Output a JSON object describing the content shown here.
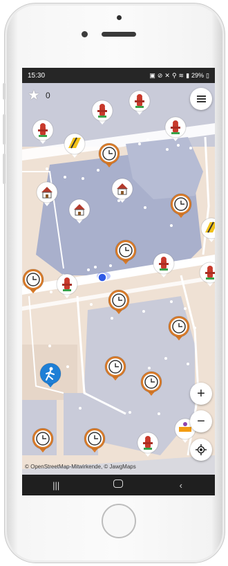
{
  "status_bar": {
    "time": "15:30",
    "battery": "29%",
    "icons": [
      "sim-card-icon",
      "no-bell-icon",
      "mute-icon",
      "location-icon",
      "wifi-icon",
      "signal-icon"
    ]
  },
  "top_bar": {
    "stars_count": "0",
    "menu_icon": "hamburger-menu-icon"
  },
  "map_controls": {
    "zoom_in": "+",
    "zoom_out": "−",
    "locate_icon": "my-location-icon"
  },
  "attribution": "© OpenStreetMap-Mitwirkende, © JawgMaps",
  "nav_bar": {
    "recents": "|||",
    "home": "home-icon",
    "back": "‹"
  },
  "map": {
    "colors": {
      "land": "#efe1d4",
      "building": "#a9b0cc",
      "block": "#c9cbd9",
      "road": "#ffffff",
      "pin_border_clock": "#d97b29",
      "pin_border_generic": "#ffffff"
    },
    "pin_types": [
      "fire-hydrant",
      "clock",
      "house",
      "roadworks",
      "pedestrian",
      "construction"
    ],
    "pins": [
      {
        "kind": "fire-hydrant"
      },
      {
        "kind": "fire-hydrant"
      },
      {
        "kind": "fire-hydrant"
      },
      {
        "kind": "fire-hydrant"
      },
      {
        "kind": "roadworks"
      },
      {
        "kind": "clock"
      },
      {
        "kind": "house"
      },
      {
        "kind": "house"
      },
      {
        "kind": "house"
      },
      {
        "kind": "clock"
      },
      {
        "kind": "clock"
      },
      {
        "kind": "clock"
      },
      {
        "kind": "fire-hydrant"
      },
      {
        "kind": "fire-hydrant"
      },
      {
        "kind": "fire-hydrant"
      },
      {
        "kind": "clock"
      },
      {
        "kind": "clock"
      },
      {
        "kind": "clock"
      },
      {
        "kind": "clock"
      },
      {
        "kind": "pedestrian"
      },
      {
        "kind": "clock"
      },
      {
        "kind": "clock"
      },
      {
        "kind": "fire-hydrant"
      },
      {
        "kind": "construction"
      },
      {
        "kind": "roadworks"
      }
    ]
  }
}
